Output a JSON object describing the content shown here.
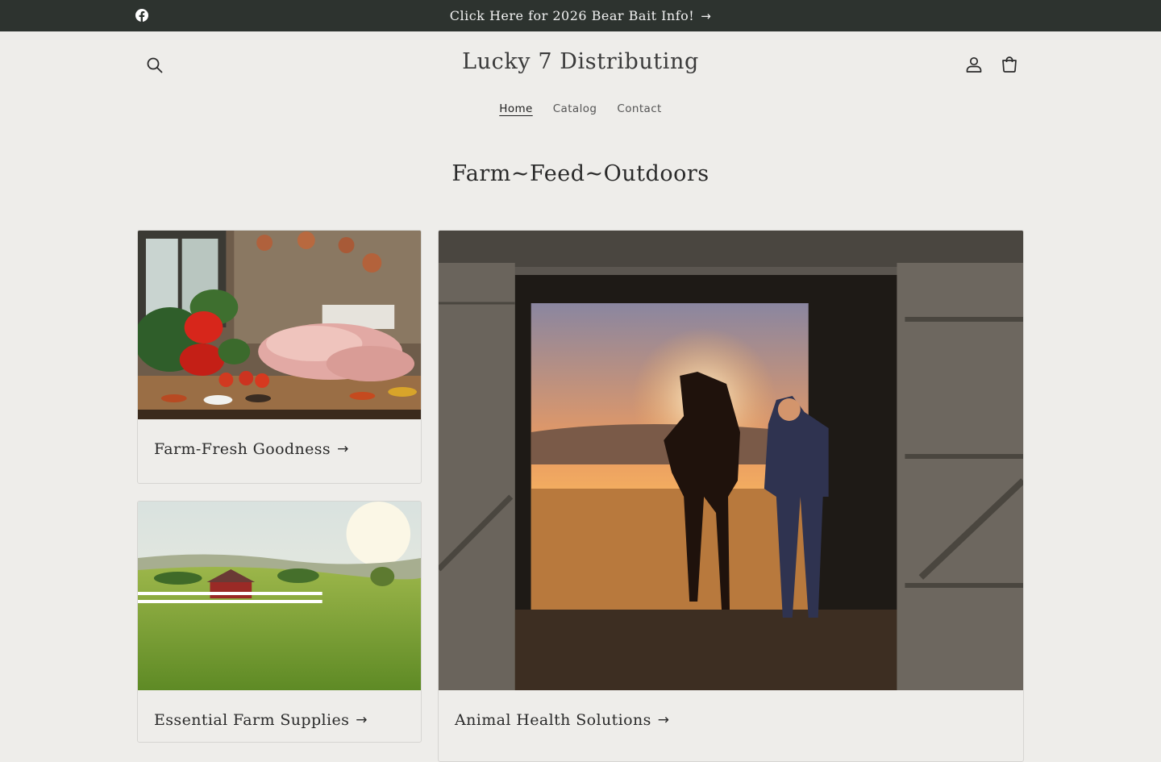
{
  "announcement": {
    "text": "Click Here for 2026 Bear Bait Info!",
    "arrow": "→",
    "social_icon": "facebook-icon"
  },
  "header": {
    "logo": "Lucky 7 Distributing",
    "icons": [
      "search-icon",
      "account-icon",
      "cart-icon"
    ]
  },
  "nav": {
    "items": [
      {
        "label": "Home",
        "active": true
      },
      {
        "label": "Catalog",
        "active": false
      },
      {
        "label": "Contact",
        "active": false
      }
    ]
  },
  "main": {
    "title": "Farm~Feed~Outdoors",
    "collections": [
      {
        "label": "Farm-Fresh Goodness",
        "arrow": "→"
      },
      {
        "label": "Essential Farm Supplies",
        "arrow": "→"
      },
      {
        "label": "Animal Health Solutions",
        "arrow": "→"
      }
    ]
  },
  "colors": {
    "announcement_bg": "#2d332f",
    "page_bg": "#eeedea",
    "text": "#1f1f1f"
  }
}
